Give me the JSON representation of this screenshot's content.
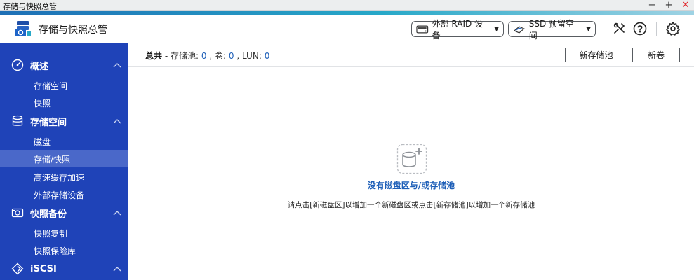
{
  "window": {
    "title": "存储与快照总管",
    "minimize": "−",
    "maximize": "+",
    "close": "✕"
  },
  "header": {
    "app_title": "存储与快照总管",
    "raid_button": "外部 RAID 设备",
    "ssd_button": "SSD 预留空间",
    "icons": [
      "logo-icon",
      "disk-icon",
      "ssd-icon",
      "tools-icon",
      "help-icon",
      "gear-icon"
    ]
  },
  "sidebar": {
    "groups": [
      {
        "label": "概述",
        "icon": "dashboard-icon",
        "items": [
          "存储空间",
          "快照"
        ]
      },
      {
        "label": "存储空间",
        "icon": "database-icon",
        "items": [
          "磁盘",
          "存储/快照",
          "高速缓存加速",
          "外部存储设备"
        ]
      },
      {
        "label": "快照备份",
        "icon": "camera-icon",
        "items": [
          "快照复制",
          "快照保险库"
        ]
      },
      {
        "label": "iSCSI",
        "icon": "iscsi-icon",
        "items": []
      }
    ],
    "active_item": "存储/快照"
  },
  "main": {
    "summary": {
      "total_label": "总共",
      "pool_label": "存储池:",
      "pool_count": "0",
      "volume_label": "卷:",
      "volume_count": "0",
      "lun_label": "LUN:",
      "lun_count": "0"
    },
    "new_pool_button": "新存储池",
    "new_volume_button": "新卷",
    "empty_title": "没有磁盘区与/或存储池",
    "empty_desc": "请点击[新磁盘区]以增加一个新磁盘区或点击[新存储池]以增加一个新存储池"
  },
  "colors": {
    "sidebar": "#1f43b8",
    "sidebar_active": "#4a68c9",
    "link": "#1e5fb8",
    "accent": "#27a8c8",
    "close": "#e0282e"
  }
}
